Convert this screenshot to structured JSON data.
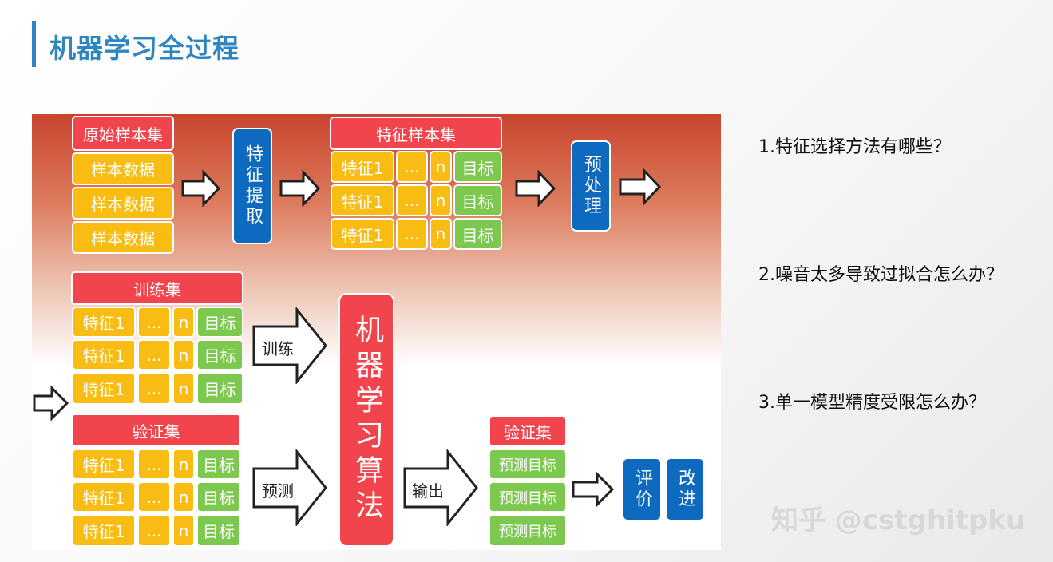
{
  "slide": {
    "title": "机器学习全过程"
  },
  "top": {
    "raw_header": "原始样本集",
    "raw_rows": [
      "样本数据",
      "样本数据",
      "样本数据"
    ],
    "extract_label": "特征提取",
    "feature_header": "特征样本集",
    "preprocess_label": "预处理"
  },
  "row": {
    "feature": "特征1",
    "dots": "...",
    "n": "n",
    "target": "目标"
  },
  "train": {
    "header": "训练集",
    "arrow_label": "训练"
  },
  "valid": {
    "header": "验证集",
    "arrow_label": "预测"
  },
  "algorithm": {
    "label": "机器学习算法"
  },
  "output": {
    "arrow_label": "输出",
    "header": "验证集",
    "rows": [
      "预测目标",
      "预测目标",
      "预测目标"
    ],
    "evaluate": "评价",
    "improve": "改进"
  },
  "questions": [
    "1.特征选择方法有哪些？",
    "2.噪音太多导致过拟合怎么办？",
    "3.单一模型精度受限怎么办？"
  ],
  "watermark": "知乎 @cstghitpku",
  "colors": {
    "red": "#f1444c",
    "yellow": "#f8bc12",
    "green": "#7dc94f",
    "blue": "#0d6abf",
    "title": "#2e86c1"
  }
}
